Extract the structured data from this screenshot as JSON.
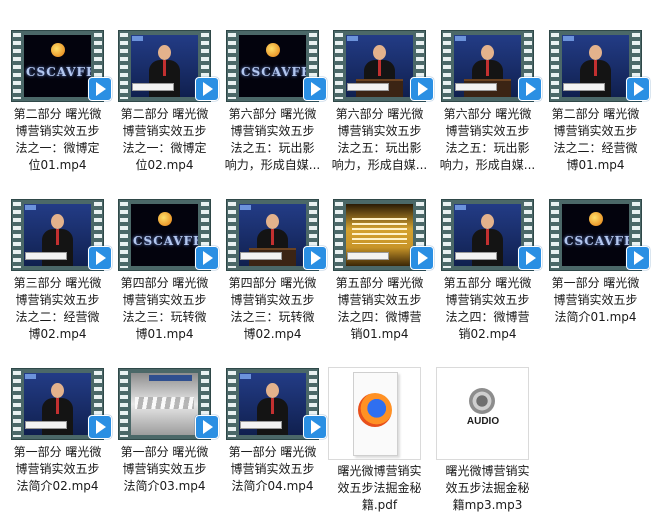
{
  "files": [
    {
      "thumb": "logo",
      "play_icon": "play-icon",
      "lines": [
        "第二部分 曙光微",
        "博营销实效五步",
        "法之一：微博定",
        "位01.mp4"
      ]
    },
    {
      "thumb": "speaker",
      "play_icon": "play-icon",
      "lines": [
        "第二部分 曙光微",
        "博营销实效五步",
        "法之一：微博定",
        "位02.mp4"
      ]
    },
    {
      "thumb": "logo",
      "play_icon": "play-icon",
      "lines": [
        "第六部分 曙光微",
        "博营销实效五步",
        "法之五：玩出影",
        "响力，形成自媒..."
      ]
    },
    {
      "thumb": "podium",
      "play_icon": "play-icon",
      "lines": [
        "第六部分 曙光微",
        "博营销实效五步",
        "法之五：玩出影",
        "响力，形成自媒..."
      ]
    },
    {
      "thumb": "podium",
      "play_icon": "play-icon",
      "lines": [
        "第六部分 曙光微",
        "博营销实效五步",
        "法之五：玩出影",
        "响力，形成自媒..."
      ]
    },
    {
      "thumb": "speaker",
      "play_icon": "play-icon",
      "lines": [
        "第二部分 曙光微",
        "博营销实效五步",
        "法之二：经营微",
        "博01.mp4"
      ]
    },
    {
      "thumb": "speaker",
      "play_icon": "play-icon",
      "lines": [
        "第三部分 曙光微",
        "博营销实效五步",
        "法之二：经营微",
        "博02.mp4"
      ]
    },
    {
      "thumb": "logo",
      "play_icon": "play-icon",
      "lines": [
        "第四部分 曙光微",
        "博营销实效五步",
        "法之三：玩转微",
        "博01.mp4"
      ]
    },
    {
      "thumb": "podium",
      "play_icon": "play-icon",
      "lines": [
        "第四部分 曙光微",
        "博营销实效五步",
        "法之三：玩转微",
        "博02.mp4"
      ]
    },
    {
      "thumb": "doc",
      "play_icon": "play-icon",
      "lines": [
        "第五部分 曙光微",
        "博营销实效五步",
        "法之四：微博营",
        "销01.mp4"
      ]
    },
    {
      "thumb": "speaker",
      "play_icon": "play-icon",
      "lines": [
        "第五部分 曙光微",
        "博营销实效五步",
        "法之四：微博营",
        "销02.mp4"
      ]
    },
    {
      "thumb": "logo",
      "play_icon": "play-icon",
      "lines": [
        "第一部分 曙光微",
        "博营销实效五步",
        "法简介01.mp4"
      ]
    },
    {
      "thumb": "speaker",
      "play_icon": "play-icon",
      "lines": [
        "第一部分 曙光微",
        "博营销实效五步",
        "法简介02.mp4"
      ]
    },
    {
      "thumb": "gray",
      "play_icon": "play-icon",
      "lines": [
        "第一部分 曙光微",
        "博营销实效五步",
        "法简介03.mp4"
      ]
    },
    {
      "thumb": "speaker",
      "play_icon": "play-icon",
      "lines": [
        "第一部分 曙光微",
        "博营销实效五步",
        "法简介04.mp4"
      ]
    },
    {
      "thumb": "pdf",
      "icon": "firefox-pdf-icon",
      "lines": [
        "曙光微博营销实",
        "效五步法掘金秘",
        "籍.pdf"
      ]
    },
    {
      "thumb": "audio",
      "icon": "audio-speaker-icon",
      "audio_label": "AUDIO",
      "lines": [
        "曙光微博营销实",
        "效五步法掘金秘",
        "籍mp3.mp3"
      ]
    }
  ],
  "logo_text": "CSCAVFH",
  "colors": {
    "play_button": "#2a8fe3",
    "filmstrip": "#4b6868"
  }
}
